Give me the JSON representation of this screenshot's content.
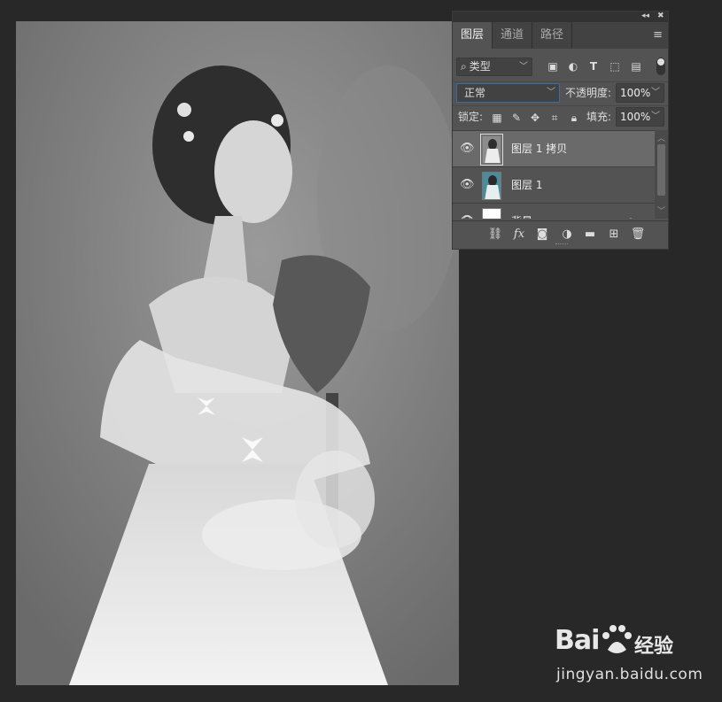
{
  "panel": {
    "tabs": [
      {
        "label": "图层",
        "active": true
      },
      {
        "label": "通道",
        "active": false
      },
      {
        "label": "路径",
        "active": false
      }
    ],
    "filter": {
      "search_icon": "search-icon",
      "kind_label": "类型"
    },
    "blend_mode": "正常",
    "opacity_label": "不透明度:",
    "opacity_value": "100%",
    "lock_label": "锁定:",
    "fill_label": "填充:",
    "fill_value": "100%",
    "layers": [
      {
        "name": "图层 1 拷贝",
        "visible": true,
        "selected": true
      },
      {
        "name": "图层 1",
        "visible": true,
        "selected": false
      },
      {
        "name": "背景",
        "visible": true,
        "selected": false,
        "locked": true
      }
    ]
  },
  "watermark": {
    "brand_left": "Bai",
    "brand_right": "经验",
    "url": "jingyan.baidu.com"
  },
  "colors": {
    "workspace": "#282828",
    "panel": "#535353",
    "selected_layer": "#6a6a6a",
    "accent_border": "#3b6ca6"
  }
}
